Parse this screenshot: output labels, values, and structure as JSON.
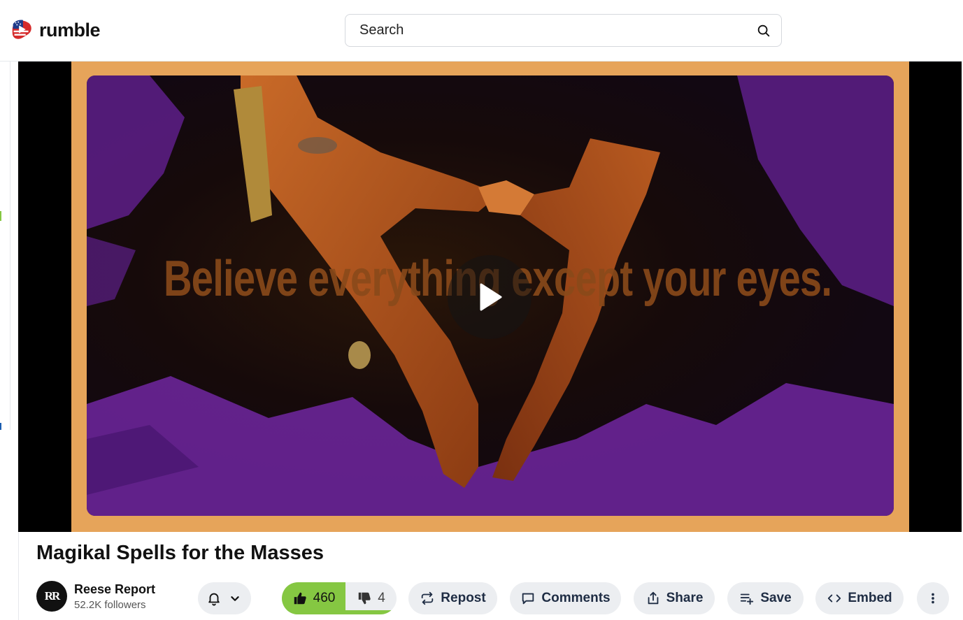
{
  "header": {
    "logo_text": "rumble",
    "search_placeholder": "Search"
  },
  "video": {
    "overlay_text": "Believe everything except your eyes."
  },
  "title": "Magikal Spells for the Masses",
  "channel": {
    "avatar_initials": "RR",
    "name": "Reese Report",
    "followers": "52.2K followers"
  },
  "votes": {
    "likes": "460",
    "dislikes": "4",
    "like_fraction": 0.991
  },
  "actions": {
    "repost": "Repost",
    "comments": "Comments",
    "share": "Share",
    "save": "Save",
    "embed": "Embed"
  },
  "colors": {
    "brand_green": "#85c742",
    "pill_bg": "#eceef1",
    "frame_orange": "#e6a45a"
  }
}
